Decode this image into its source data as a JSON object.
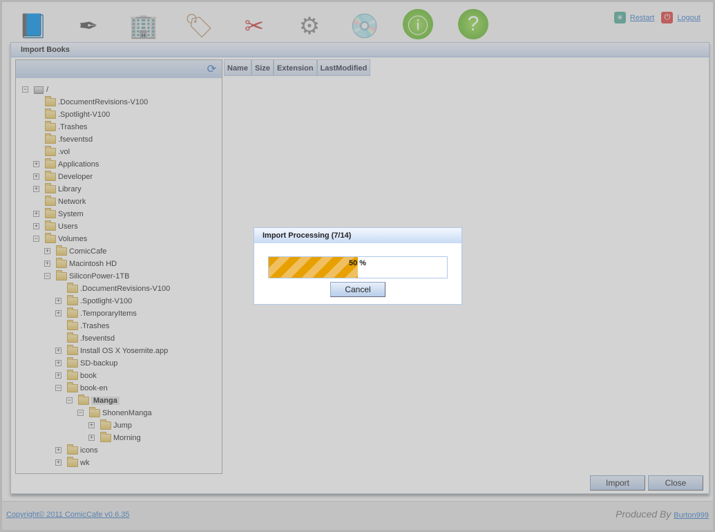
{
  "toolbar": {
    "icons": [
      "add-book-icon",
      "add-author-icon",
      "add-publisher-icon",
      "add-tag-icon",
      "tools-icon",
      "settings-icon",
      "import-disc-icon",
      "info-icon",
      "help-icon"
    ],
    "restart": "Restart",
    "logout": "Logout"
  },
  "window": {
    "title": "Import Books"
  },
  "table": {
    "columns": [
      "Name",
      "Size",
      "Extension",
      "LastModified"
    ]
  },
  "tree": [
    {
      "label": "/",
      "depth": 0,
      "exp": "-",
      "root": true
    },
    {
      "label": ".DocumentRevisions-V100",
      "depth": 1,
      "exp": ""
    },
    {
      "label": ".Spotlight-V100",
      "depth": 1,
      "exp": ""
    },
    {
      "label": ".Trashes",
      "depth": 1,
      "exp": ""
    },
    {
      "label": ".fseventsd",
      "depth": 1,
      "exp": ""
    },
    {
      "label": ".vol",
      "depth": 1,
      "exp": ""
    },
    {
      "label": "Applications",
      "depth": 1,
      "exp": "+"
    },
    {
      "label": "Developer",
      "depth": 1,
      "exp": "+"
    },
    {
      "label": "Library",
      "depth": 1,
      "exp": "+"
    },
    {
      "label": "Network",
      "depth": 1,
      "exp": ""
    },
    {
      "label": "System",
      "depth": 1,
      "exp": "+"
    },
    {
      "label": "Users",
      "depth": 1,
      "exp": "+"
    },
    {
      "label": "Volumes",
      "depth": 1,
      "exp": "-"
    },
    {
      "label": "ComicCafe",
      "depth": 2,
      "exp": "+"
    },
    {
      "label": "Macintosh HD",
      "depth": 2,
      "exp": "+"
    },
    {
      "label": "SiliconPower-1TB",
      "depth": 2,
      "exp": "-"
    },
    {
      "label": ".DocumentRevisions-V100",
      "depth": 3,
      "exp": ""
    },
    {
      "label": ".Spotlight-V100",
      "depth": 3,
      "exp": "+"
    },
    {
      "label": ".TemporaryItems",
      "depth": 3,
      "exp": "+"
    },
    {
      "label": ".Trashes",
      "depth": 3,
      "exp": ""
    },
    {
      "label": ".fseventsd",
      "depth": 3,
      "exp": ""
    },
    {
      "label": "Install OS X Yosemite.app",
      "depth": 3,
      "exp": "+"
    },
    {
      "label": "SD-backup",
      "depth": 3,
      "exp": "+"
    },
    {
      "label": "book",
      "depth": 3,
      "exp": "+"
    },
    {
      "label": "book-en",
      "depth": 3,
      "exp": "-"
    },
    {
      "label": "Manga",
      "depth": 4,
      "exp": "-",
      "selected": true
    },
    {
      "label": "ShonenManga",
      "depth": 5,
      "exp": "-"
    },
    {
      "label": "Jump",
      "depth": 6,
      "exp": "+"
    },
    {
      "label": "Morning",
      "depth": 6,
      "exp": "+"
    },
    {
      "label": "icons",
      "depth": 3,
      "exp": "+"
    },
    {
      "label": "wk",
      "depth": 3,
      "exp": "+"
    }
  ],
  "buttons": {
    "import": "Import",
    "close": "Close"
  },
  "footer": {
    "copyright": "Copyright© 2011 ComicCafe v0.6.35",
    "produced_by": "Produced By",
    "author": "Burton999"
  },
  "dialog": {
    "title": "Import Processing (7/14)",
    "progress_percent": 50,
    "progress_text": "50 %",
    "cancel": "Cancel"
  }
}
